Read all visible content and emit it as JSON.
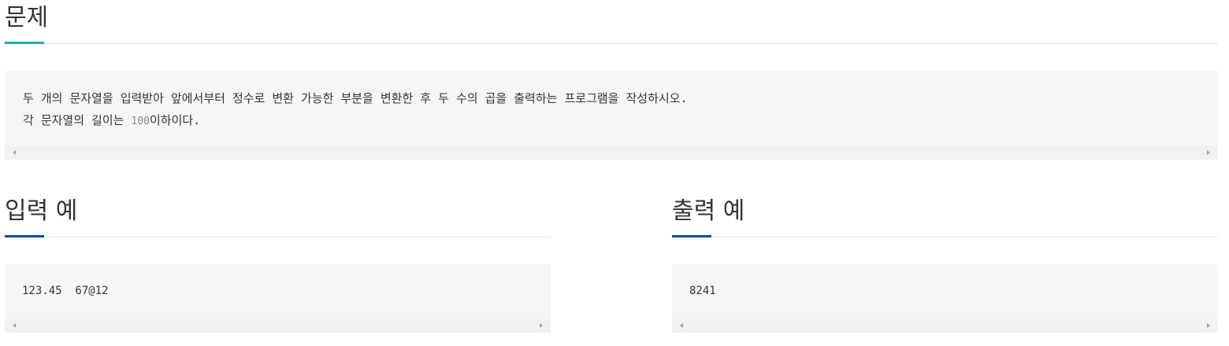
{
  "colors": {
    "problem_accent": "#1aaea7",
    "example_accent": "#0c4da2",
    "box_background": "#f6f6f8",
    "divider": "#e2e2e2"
  },
  "problem": {
    "title": "문제",
    "line1": "두 개의 문자열을 입력받아 앞에서부터 정수로 변환 가능한 부분을 변환한 후 두 수의 곱을 출력하는 프로그램을 작성하시오.",
    "line2_before": "각 문자열의 길이는 ",
    "line2_number": "100",
    "line2_after": "이하이다."
  },
  "input_example": {
    "title": "입력 예",
    "content": "123.45  67@12"
  },
  "output_example": {
    "title": "출력 예",
    "content": "8241"
  }
}
